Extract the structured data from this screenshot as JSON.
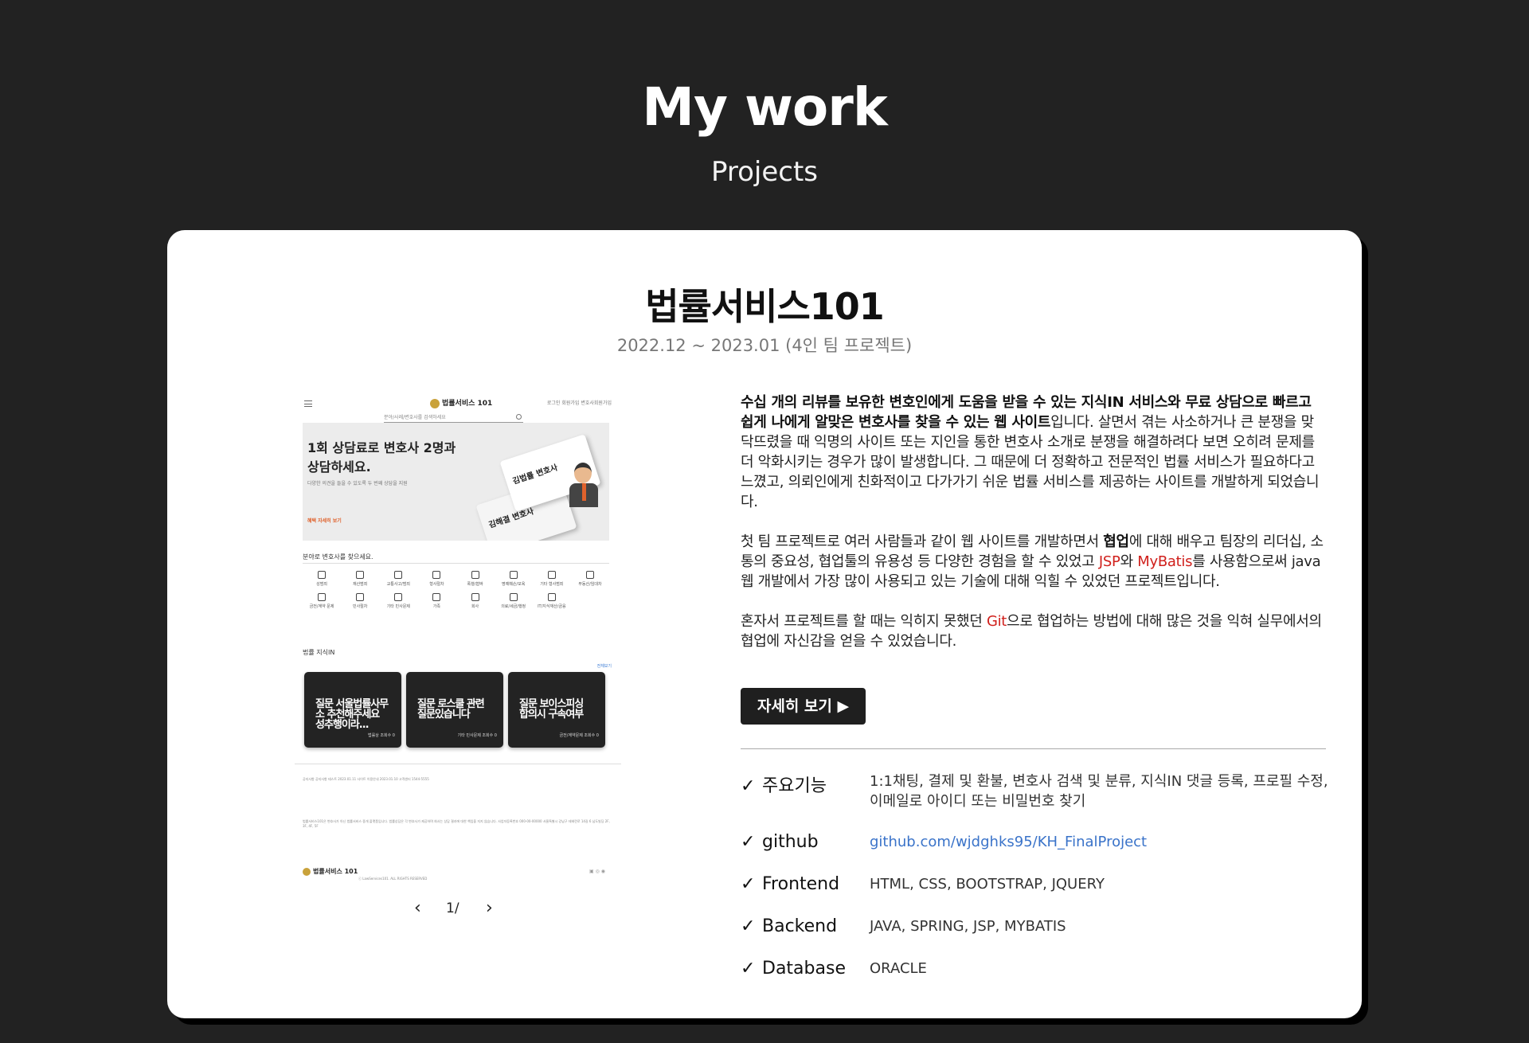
{
  "header": {
    "title": "My work",
    "subtitle": "Projects"
  },
  "project": {
    "title": "법률서비스101",
    "period": "2022.12 ~ 2023.01 (4인 팀 프로젝트)",
    "preview": {
      "logo": "법률서비스 101",
      "top_links": "로그인 회원가입 변호사회원가입",
      "search_placeholder": "분야/사례/변호사를 검색하세요",
      "hero_title": "1회 상담료로 변호사 2명과 상담하세요.",
      "hero_desc": "다양한 의견을 들을 수 있도록 두 번째 상담을 지원",
      "hero_link": "혜택 자세히 보기",
      "card1": "김법률 변호사",
      "card2": "김해결 변호사",
      "section_categories": "분야로 변호사를 찾으세요.",
      "categories": [
        "성범죄",
        "재산범죄",
        "교통사고/범죄",
        "형사절차",
        "폭행/협박",
        "명예훼손/모욕",
        "기타 형사범죄",
        "부동산/임대차",
        "금전/계약 문제",
        "민사절차",
        "기타 민사문제",
        "가족",
        "회사",
        "의료/세금/행정",
        "IT/지식재산/금융"
      ],
      "section_qna": "법률 지식IN",
      "more_link": "전체보기",
      "questions": [
        {
          "text": "질문 서울법률사무소 추천해주세요 성추행이라...",
          "meta": "법률상 조회수 0"
        },
        {
          "text": "질문 로스쿨 관련 질문있습니다",
          "meta": "기타 민사문제 조회수 0"
        },
        {
          "text": "질문 보이스피싱 합의시 구속여부",
          "meta": "금전/계약문제 조회수 0"
        }
      ],
      "footer_notice": "공지사항  공지사항 테스트 2023.01.11  사이트 이용안내 2023.01.10  고객센터 1544-5555",
      "footer_legal": "법률서비스101은 변호사가 아닌 법률서비스 중개 플랫폼입니다. 법률상담은 각 변호사가 제공하며 회사는 상담 결과에 대한 책임을 지지 않습니다. 사업자등록번호 000-00-00000 서울특별시 강남구 테헤란로 14길 6 남도빌딩 2F, 3F, 4F, 5F",
      "footer_logo": "법률서비스 101",
      "footer_copy": "ⓒ LawServices101. ALL RIGHTS RESERVED",
      "footer_sns": "▣ ◎ ◉",
      "pager": "1/"
    },
    "description": {
      "p1_bold": "수십 개의 리뷰를 보유한 변호인에게 도움을 받을 수 있는 지식IN 서비스와 무료 상담으로 빠르고 쉽게 나에게 알맞은 변호사를 찾을 수 있는 웹 사이트",
      "p1_rest": "입니다. 살면서 겪는 사소하거나 큰 분쟁을 맞닥뜨렸을 때 익명의 사이트 또는 지인을 통한 변호사 소개로 분쟁을 해결하려다 보면 오히려 문제를 더 악화시키는 경우가 많이 발생합니다. 그 때문에 더 정확하고 전문적인 법률 서비스가 필요하다고 느꼈고, 의뢰인에게 친화적이고 다가가기 쉬운 법률 서비스를 제공하는 사이트를 개발하게 되었습니다.",
      "p2_a": "첫 팀 프로젝트로 여러 사람들과 같이 웹 사이트를 개발하면서 ",
      "p2_bold": "협업",
      "p2_b": "에 대해 배우고 팀장의 리더십, 소통의 중요성, 협업툴의 유용성 등 다양한 경험을 할 수 있었고 ",
      "p2_jsp": "JSP",
      "p2_c": "와 ",
      "p2_mybatis": "MyBatis",
      "p2_d": "를 사용함으로써 java 웹 개발에서 가장 많이 사용되고 있는 기술에 대해 익힐 수 있었던 프로젝트입니다.",
      "p3_a": "혼자서 프로젝트를 할 때는 익히지 못했던 ",
      "p3_git": "Git",
      "p3_b": "으로 협업하는 방법에 대해 많은 것을 익혀 실무에서의 협업에 자신감을 얻을 수 있었습니다."
    },
    "detail_button": "자세히 보기 ▶",
    "info": [
      {
        "label": "주요기능",
        "value": "1:1채팅, 결제 및 환불, 변호사 검색 및 분류, 지식IN 댓글 등록, 프로필 수정, 이메일로 아이디 또는 비밀번호 찾기"
      },
      {
        "label": "github",
        "value": "github.com/wjdghks95/KH_FinalProject"
      },
      {
        "label": "Frontend",
        "value": "HTML, CSS, BOOTSTRAP, JQUERY"
      },
      {
        "label": "Backend",
        "value": "JAVA, SPRING, JSP, MYBATIS"
      },
      {
        "label": "Database",
        "value": "ORACLE"
      }
    ],
    "check_mark": "✓"
  },
  "colors": {
    "background": "#222222",
    "card": "#ffffff",
    "accent_red": "#d0201c",
    "link_blue": "#3a73c9",
    "button_dark": "#1f1f1f"
  }
}
